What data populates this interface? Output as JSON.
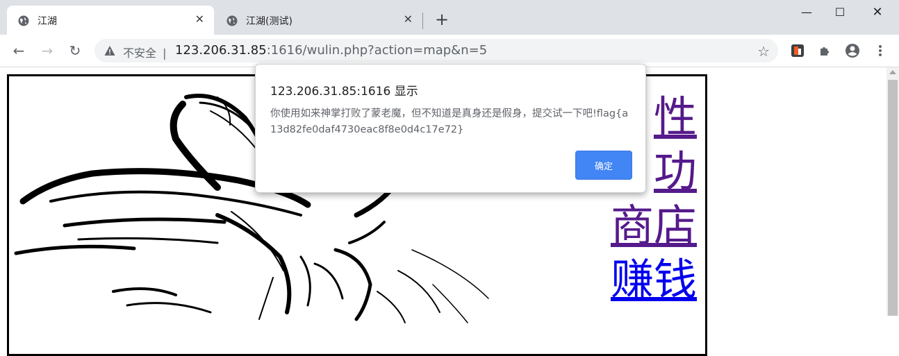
{
  "tabs": [
    {
      "title": "江湖",
      "close": "✕",
      "icon": "globe-icon"
    },
    {
      "title": "江湖(测试)",
      "close": "✕",
      "icon": "globe-icon"
    }
  ],
  "new_tab": "+",
  "window": {
    "minimize": "—",
    "maximize": "☐",
    "close": "✕"
  },
  "nav": {
    "back": "←",
    "forward": "→",
    "reload": "↻"
  },
  "omnibox": {
    "insecure_label": "不安全",
    "separator": "|",
    "url_host": "123.206.31.85",
    "url_rest": ":1616/wulin.php?action=map&n=5",
    "star": "☆"
  },
  "page": {
    "links": [
      {
        "label": "性",
        "color": "#551a8b"
      },
      {
        "label": "功",
        "color": "#551a8b"
      },
      {
        "label": "商店",
        "color": "#551a8b"
      },
      {
        "label": "赚钱",
        "color": "#0000ee"
      }
    ]
  },
  "dialog": {
    "title": "123.206.31.85:1616 显示",
    "message": "你使用如来神掌打败了蒙老魔，但不知道是真身还是假身，提交试一下吧!flag{a13d82fe0daf4730eac8f8e0d4c17e72}",
    "ok_label": "确定"
  },
  "colors": {
    "accent": "#4285f4",
    "tabbar": "#dee1e6",
    "omnibox": "#f1f3f4"
  }
}
